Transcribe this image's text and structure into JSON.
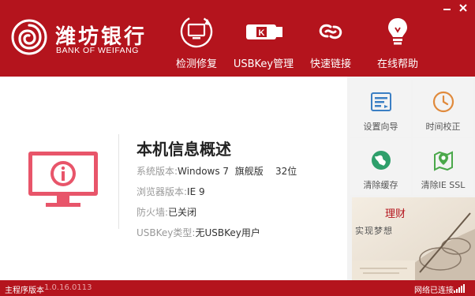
{
  "brand": {
    "name_cn": "潍坊银行",
    "name_en": "BANK OF WEIFANG"
  },
  "window_controls": {
    "minimize": "minimize-icon",
    "close": "close-icon"
  },
  "nav": [
    {
      "label": "检测修复",
      "icon": "monitor-refresh-icon"
    },
    {
      "label": "USBKey管理",
      "icon": "usb-key-icon"
    },
    {
      "label": "快速链接",
      "icon": "link-icon"
    },
    {
      "label": "在线帮助",
      "icon": "lightbulb-icon"
    }
  ],
  "tools": [
    {
      "label": "设置向导",
      "icon": "settings-wizard-icon"
    },
    {
      "label": "时间校正",
      "icon": "clock-icon"
    },
    {
      "label": "清除缓存",
      "icon": "globe-clean-icon"
    },
    {
      "label": "清除IE SSL",
      "icon": "map-pin-icon"
    }
  ],
  "banner": {
    "text1": "理财",
    "text2": "实现梦想"
  },
  "summary": {
    "title": "本机信息概述",
    "rows": [
      {
        "key": "系统版本:",
        "value": "Windows 7  旗舰版    32位"
      },
      {
        "key": "浏览器版本:",
        "value": "IE 9"
      },
      {
        "key": "防火墙:",
        "value": "已关闭"
      },
      {
        "key": "USBKey类型:",
        "value": "无USBKey用户"
      }
    ]
  },
  "status": {
    "version_label": "主程序版本",
    "version": "1.0.16.0113",
    "network": "网络已连接"
  },
  "colors": {
    "brand_red": "#b4141d",
    "accent_pink": "#e8556a"
  }
}
